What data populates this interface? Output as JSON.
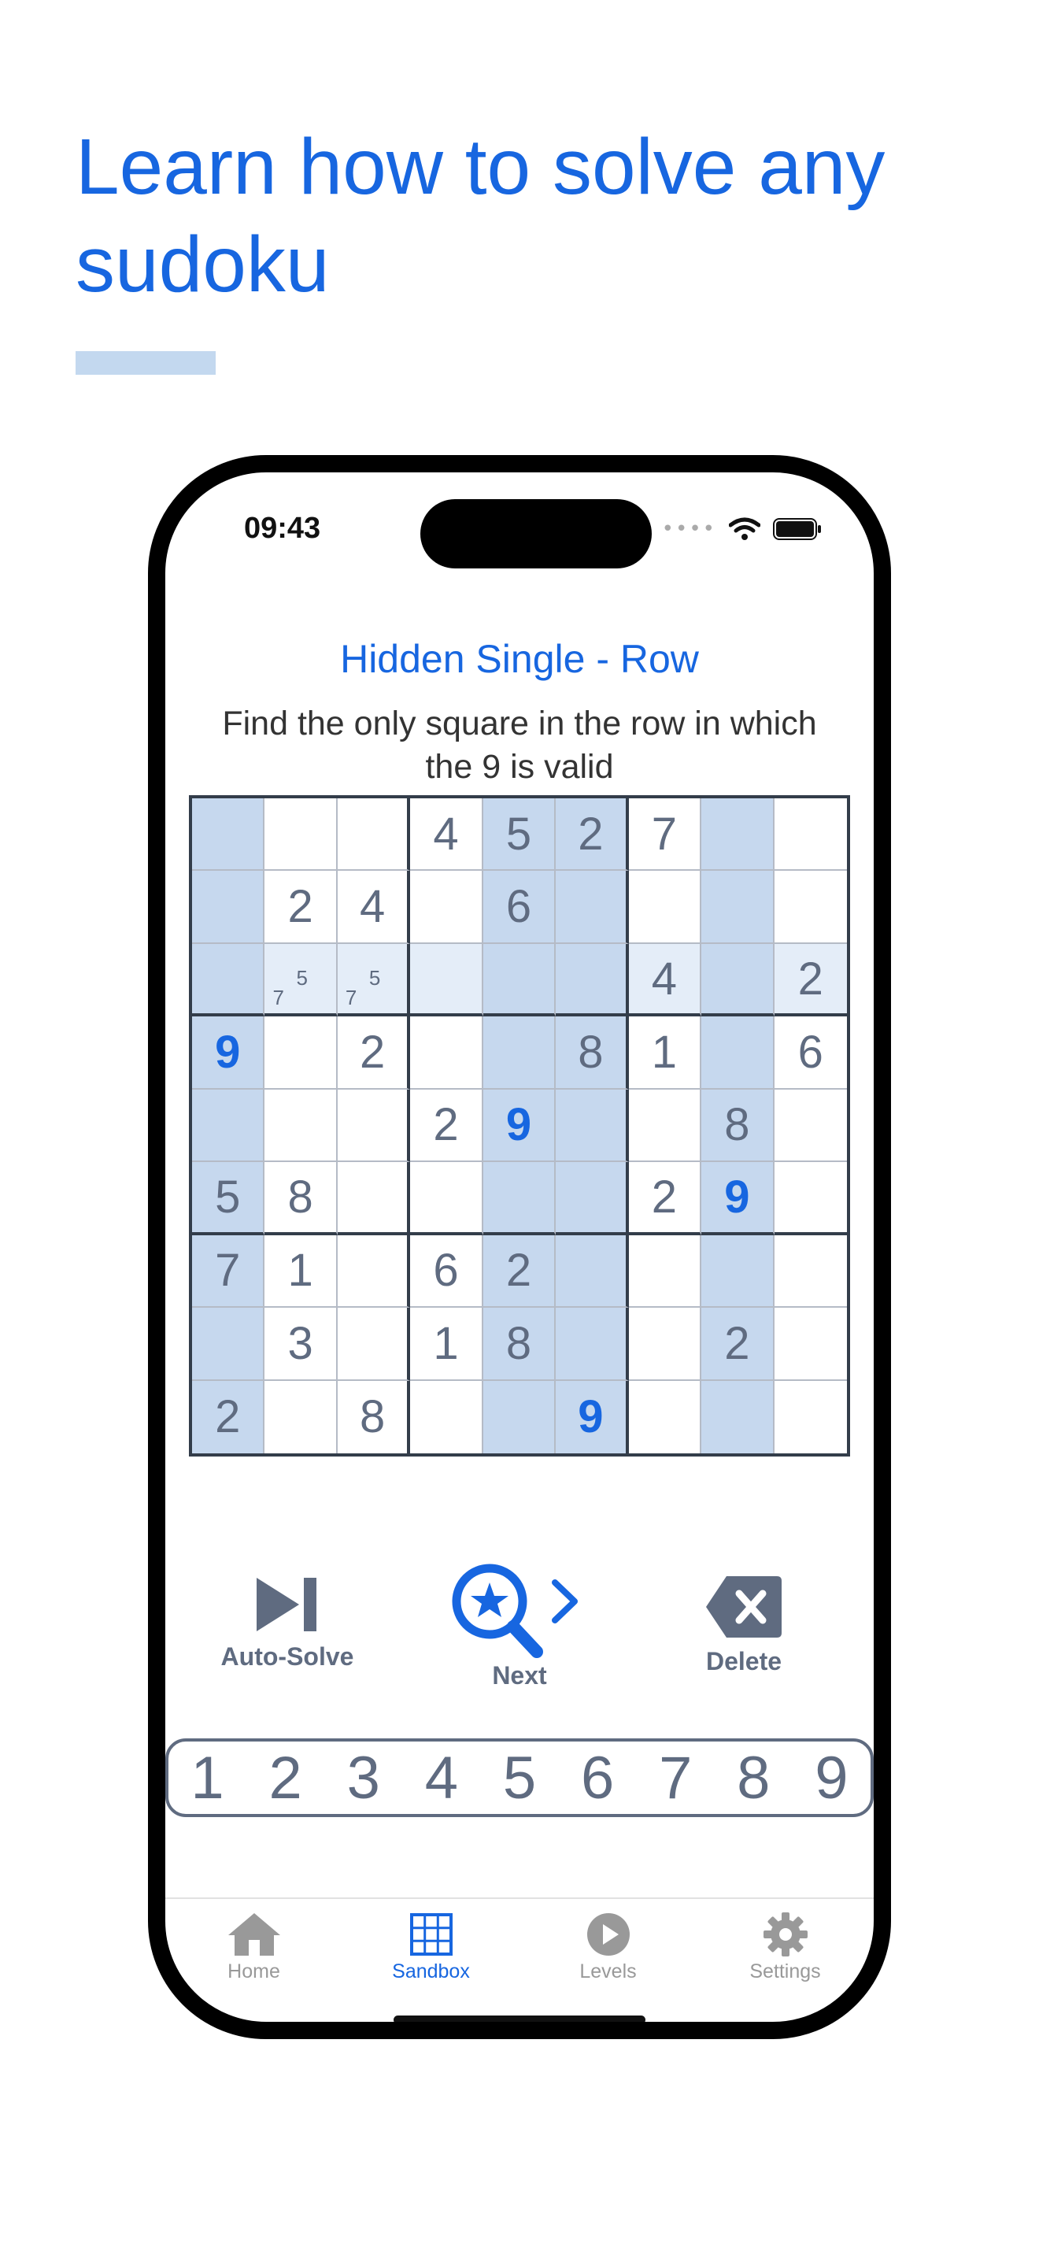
{
  "headline": "Learn how to solve any sudoku",
  "status_bar": {
    "time": "09:43"
  },
  "hint": {
    "title": "Hidden Single - Row",
    "text": "Find the only square in the row in which the 9 is valid"
  },
  "board": {
    "rows": [
      [
        "",
        "",
        "",
        "4",
        "5",
        "2",
        "7",
        "",
        ""
      ],
      [
        "",
        "2",
        "4",
        "",
        "6",
        "",
        "",
        "",
        ""
      ],
      [
        "",
        "",
        "",
        "",
        "",
        "",
        "4",
        "",
        "2"
      ],
      [
        "9",
        "",
        "2",
        "",
        "",
        "8",
        "1",
        "",
        "6"
      ],
      [
        "",
        "",
        "",
        "2",
        "9",
        "",
        "",
        "8",
        ""
      ],
      [
        "5",
        "8",
        "",
        "",
        "",
        "",
        "2",
        "9",
        ""
      ],
      [
        "7",
        "1",
        "",
        "6",
        "2",
        "",
        "",
        "",
        ""
      ],
      [
        "",
        "3",
        "",
        "1",
        "8",
        "",
        "",
        "2",
        ""
      ],
      [
        "2",
        "",
        "8",
        "",
        "",
        "9",
        "",
        "",
        ""
      ]
    ],
    "candidates": [
      {
        "row": 2,
        "col": 1,
        "values": [
          "7",
          "5"
        ]
      },
      {
        "row": 2,
        "col": 2,
        "values": [
          "7",
          "5"
        ]
      }
    ],
    "highlight_cols": [
      0,
      4,
      5,
      7
    ],
    "highlight_row": 2,
    "target_digit": "9"
  },
  "actions": {
    "auto_solve": "Auto-Solve",
    "next": "Next",
    "delete": "Delete"
  },
  "numpad": [
    "1",
    "2",
    "3",
    "4",
    "5",
    "6",
    "7",
    "8",
    "9"
  ],
  "tabs": [
    {
      "label": "Home",
      "icon": "home-icon"
    },
    {
      "label": "Sandbox",
      "icon": "grid-icon"
    },
    {
      "label": "Levels",
      "icon": "play-icon"
    },
    {
      "label": "Settings",
      "icon": "gear-icon"
    }
  ],
  "active_tab": "Sandbox",
  "colors": {
    "accent": "#1766e0",
    "highlight": "#c6d8ee",
    "highlight_light": "#e4edf8",
    "digit": "#5f6b80"
  }
}
